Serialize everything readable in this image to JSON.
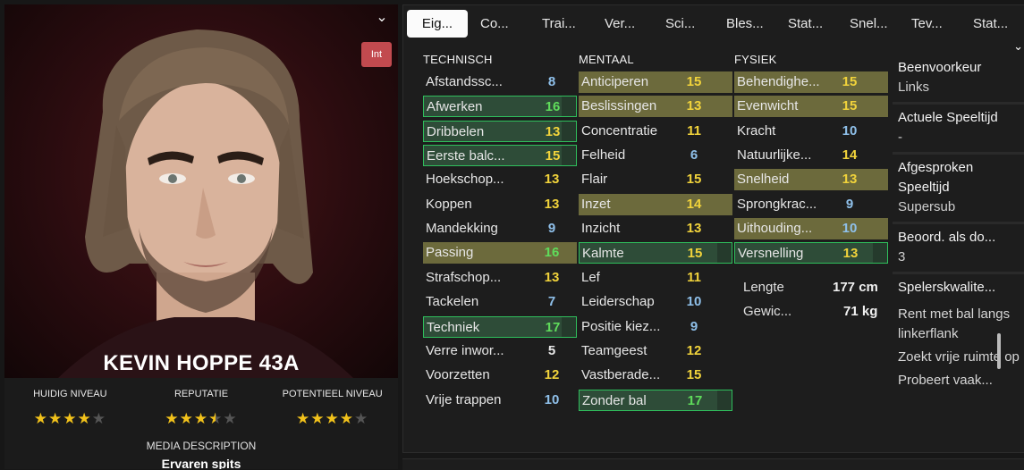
{
  "profile": {
    "name": "KEVIN HOPPE 43A",
    "badge": "Int",
    "ratings": [
      {
        "label": "HUIDIG NIVEAU",
        "stars": 4.0
      },
      {
        "label": "REPUTATIE",
        "stars": 3.5
      },
      {
        "label": "POTENTIEEL NIVEAU",
        "stars": 4.0
      }
    ],
    "media_label": "MEDIA DESCRIPTION",
    "media_value": "Ervaren spits"
  },
  "tabs": [
    "Eig...",
    "Co...",
    "Trai...",
    "Ver...",
    "Sci...",
    "Bles...",
    "Stat...",
    "Snel...",
    "Tev...",
    "Stat..."
  ],
  "columns": {
    "technisch": {
      "header": "TECHNISCH",
      "rows": [
        {
          "name": "Afstandssc...",
          "value": "8",
          "color": "blue",
          "hl": ""
        },
        {
          "name": "Afwerken",
          "value": "16",
          "color": "green",
          "hl": "green"
        },
        {
          "name": "Dribbelen",
          "value": "13",
          "color": "yellow",
          "hl": "green"
        },
        {
          "name": "Eerste balc...",
          "value": "15",
          "color": "yellow",
          "hl": "green"
        },
        {
          "name": "Hoekschop...",
          "value": "13",
          "color": "yellow",
          "hl": ""
        },
        {
          "name": "Koppen",
          "value": "13",
          "color": "yellow",
          "hl": ""
        },
        {
          "name": "Mandekking",
          "value": "9",
          "color": "blue",
          "hl": ""
        },
        {
          "name": "Passing",
          "value": "16",
          "color": "green",
          "hl": "olive"
        },
        {
          "name": "Strafschop...",
          "value": "13",
          "color": "yellow",
          "hl": ""
        },
        {
          "name": "Tackelen",
          "value": "7",
          "color": "blue",
          "hl": ""
        },
        {
          "name": "Techniek",
          "value": "17",
          "color": "green",
          "hl": "green"
        },
        {
          "name": "Verre inwor...",
          "value": "5",
          "color": "white",
          "hl": ""
        },
        {
          "name": "Voorzetten",
          "value": "12",
          "color": "yellow",
          "hl": ""
        },
        {
          "name": "Vrije trappen",
          "value": "10",
          "color": "blue",
          "hl": ""
        }
      ]
    },
    "mentaal": {
      "header": "MENTAAL",
      "rows": [
        {
          "name": "Anticiperen",
          "value": "15",
          "color": "yellow",
          "hl": "olive"
        },
        {
          "name": "Beslissingen",
          "value": "13",
          "color": "yellow",
          "hl": "olive"
        },
        {
          "name": "Concentratie",
          "value": "11",
          "color": "yellow",
          "hl": ""
        },
        {
          "name": "Felheid",
          "value": "6",
          "color": "blue",
          "hl": ""
        },
        {
          "name": "Flair",
          "value": "15",
          "color": "yellow",
          "hl": ""
        },
        {
          "name": "Inzet",
          "value": "14",
          "color": "yellow",
          "hl": "olive"
        },
        {
          "name": "Inzicht",
          "value": "13",
          "color": "yellow",
          "hl": ""
        },
        {
          "name": "Kalmte",
          "value": "15",
          "color": "yellow",
          "hl": "green"
        },
        {
          "name": "Lef",
          "value": "11",
          "color": "yellow",
          "hl": ""
        },
        {
          "name": "Leiderschap",
          "value": "10",
          "color": "blue",
          "hl": ""
        },
        {
          "name": "Positie kiez...",
          "value": "9",
          "color": "blue",
          "hl": ""
        },
        {
          "name": "Teamgeest",
          "value": "12",
          "color": "yellow",
          "hl": ""
        },
        {
          "name": "Vastberade...",
          "value": "15",
          "color": "yellow",
          "hl": ""
        },
        {
          "name": "Zonder bal",
          "value": "17",
          "color": "green",
          "hl": "green"
        }
      ]
    },
    "fysiek": {
      "header": "FYSIEK",
      "rows": [
        {
          "name": "Behendighe...",
          "value": "15",
          "color": "yellow",
          "hl": "olive"
        },
        {
          "name": "Evenwicht",
          "value": "15",
          "color": "yellow",
          "hl": "olive"
        },
        {
          "name": "Kracht",
          "value": "10",
          "color": "blue",
          "hl": ""
        },
        {
          "name": "Natuurlijke...",
          "value": "14",
          "color": "yellow",
          "hl": ""
        },
        {
          "name": "Snelheid",
          "value": "13",
          "color": "yellow",
          "hl": "olive"
        },
        {
          "name": "Sprongkrac...",
          "value": "9",
          "color": "blue",
          "hl": ""
        },
        {
          "name": "Uithouding...",
          "value": "10",
          "color": "blue",
          "hl": "olive"
        },
        {
          "name": "Versnelling",
          "value": "13",
          "color": "yellow",
          "hl": "green"
        }
      ],
      "length_label": "Lengte",
      "length_value": "177 cm",
      "weight_label": "Gewic...",
      "weight_value": "71 kg"
    }
  },
  "side": {
    "foot_title": "Beenvoorkeur",
    "foot_value": "Links",
    "playtime_title": "Actuele Speeltijd",
    "playtime_value": "-",
    "agreed_title": "Afgesproken Speeltijd",
    "agreed_value": "Supersub",
    "rating_title": "Beoord. als do...",
    "rating_value": "3",
    "qualities_title": "Spelerskwalite...",
    "qualities": [
      "Rent met bal langs linkerflank",
      "Zoekt vrije ruimte op",
      "Probeert vaak..."
    ]
  },
  "colors": {
    "green_highlight": "#2fbf5c",
    "olive_highlight": "#6c6a3c",
    "value_green": "#5fdc5b",
    "value_yellow": "#f1d33b",
    "value_blue": "#8fc0ea"
  }
}
